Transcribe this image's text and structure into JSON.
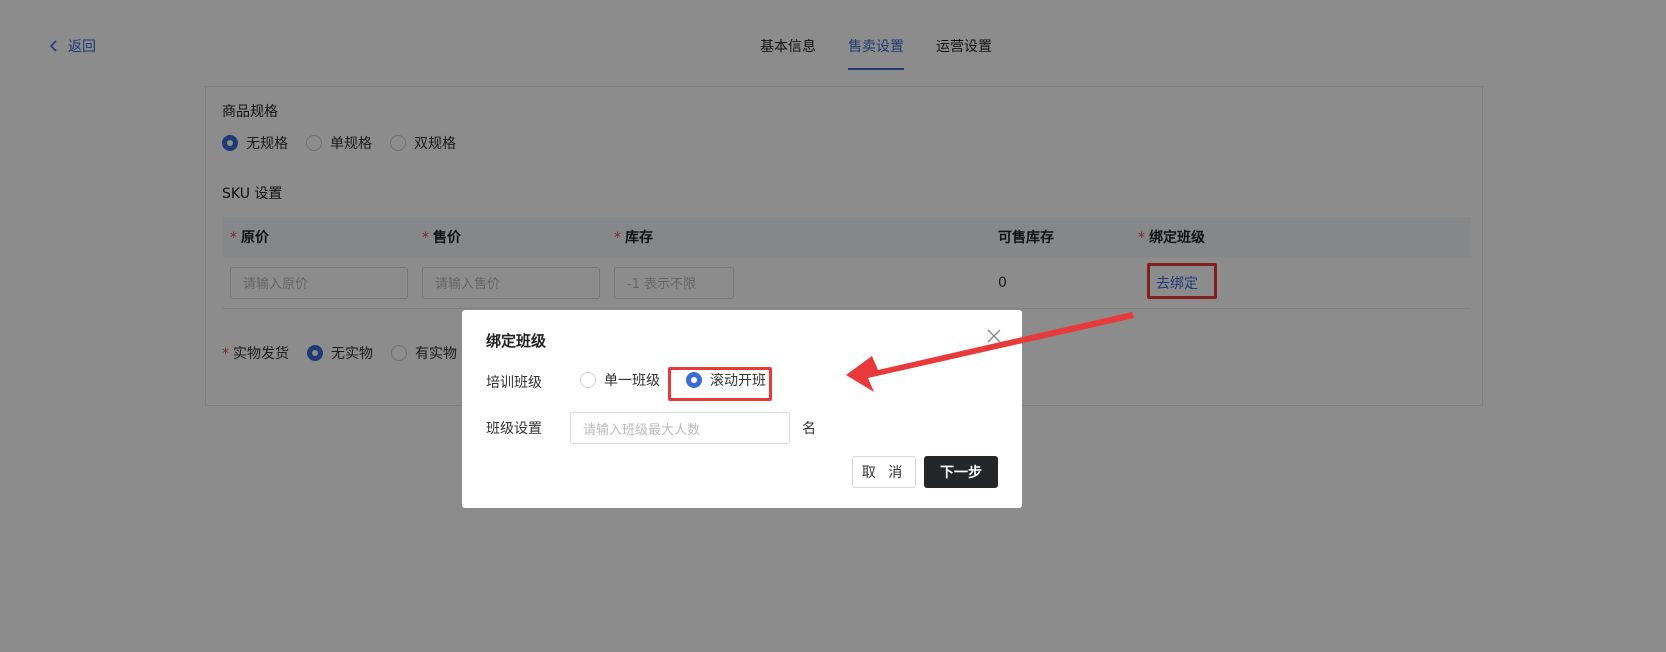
{
  "header": {
    "back_label": "返回",
    "tabs": [
      {
        "label": "基本信息",
        "active": false
      },
      {
        "label": "售卖设置",
        "active": true
      },
      {
        "label": "运营设置",
        "active": false
      }
    ]
  },
  "spec": {
    "title": "商品规格",
    "options": [
      "无规格",
      "单规格",
      "双规格"
    ],
    "selected": "无规格"
  },
  "sku": {
    "title": "SKU 设置",
    "columns": [
      {
        "label": "原价",
        "required": true
      },
      {
        "label": "售价",
        "required": true
      },
      {
        "label": "库存",
        "required": true
      },
      {
        "label": "可售库存",
        "required": false
      },
      {
        "label": "绑定班级",
        "required": true
      }
    ],
    "row": {
      "original_price_placeholder": "请输入原价",
      "sale_price_placeholder": "请输入售价",
      "stock_placeholder": "-1 表示不限",
      "available_stock": "0",
      "bind_link": "去绑定"
    }
  },
  "shipping": {
    "label": "实物发货",
    "required": true,
    "options": [
      "无实物",
      "有实物"
    ],
    "selected": "无实物"
  },
  "dialog": {
    "title": "绑定班级",
    "training_label": "培训班级",
    "training_options": [
      "单一班级",
      "滚动开班"
    ],
    "training_selected": "滚动开班",
    "class_setting_label": "班级设置",
    "class_input_placeholder": "请输入班级最大人数",
    "class_unit": "名",
    "cancel_label": "取 消",
    "next_label": "下一步"
  },
  "colors": {
    "accent": "#3b6bd6",
    "highlight": "#e8393b",
    "primary_button": "#252629"
  },
  "icons": [
    "chevron-left-icon",
    "close-icon",
    "arrow-annotation"
  ]
}
